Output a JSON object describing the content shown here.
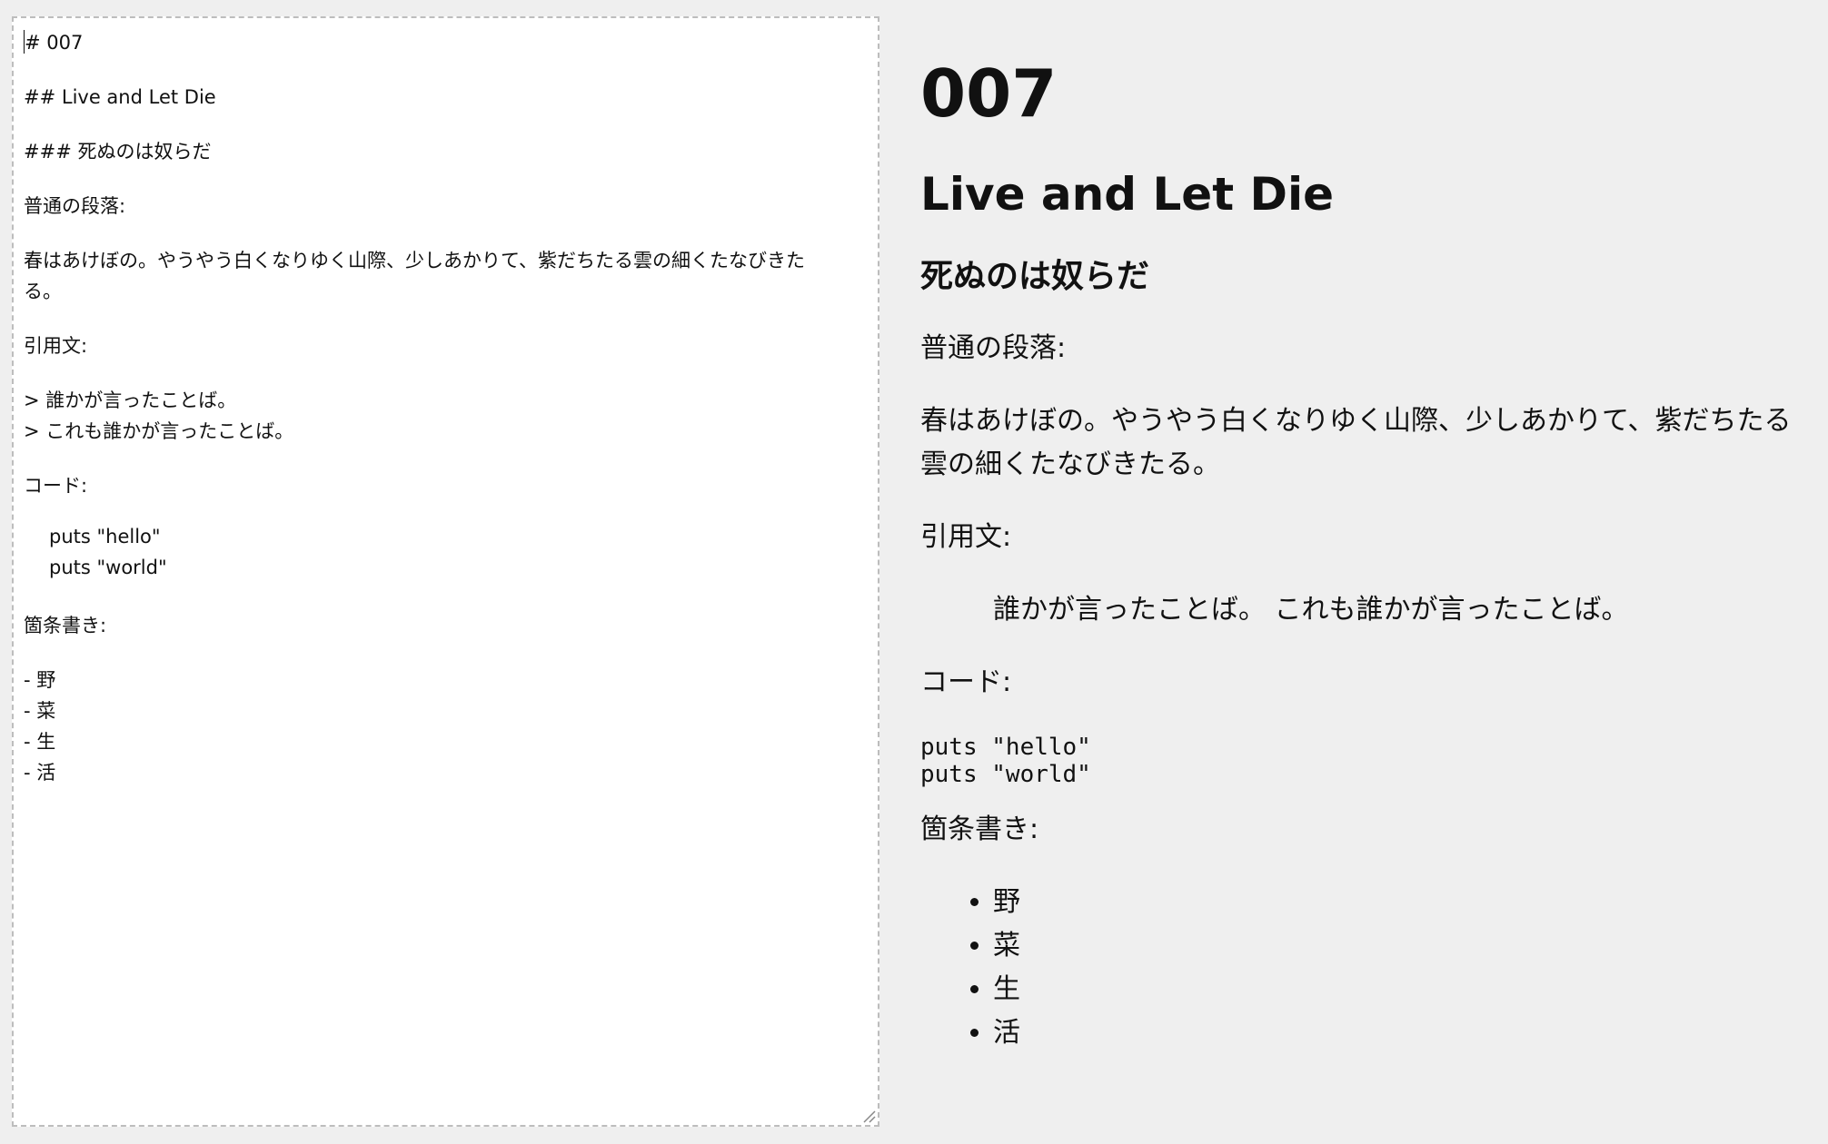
{
  "editor": {
    "lines": {
      "h1": "# 007",
      "h2": "## Live and Let Die",
      "h3": "### 死ぬのは奴らだ",
      "para_label": "普通の段落:",
      "paragraph": "春はあけぼの。やうやう白くなりゆく山際、少しあかりて、紫だちたる雲の細くたなびきたる。",
      "quote_label": "引用文:",
      "quote1": "> 誰かが言ったことば。",
      "quote2": "> これも誰かが言ったことば。",
      "code_label": "コード:",
      "code1": "puts \"hello\"",
      "code2": "puts \"world\"",
      "list_label": "箇条書き:",
      "list": [
        "- 野",
        "- 菜",
        "- 生",
        "- 活"
      ]
    },
    "resize_icon": "resize-grip-icon"
  },
  "preview": {
    "h1": "007",
    "h2": "Live and Let Die",
    "h3": "死ぬのは奴らだ",
    "para_label": "普通の段落:",
    "paragraph": "春はあけぼの。やうやう白くなりゆく山際、少しあかりて、紫だちたる雲の細くたなびきたる。",
    "quote_label": "引用文:",
    "quote": "誰かが言ったことば。 これも誰かが言ったことば。",
    "code_label": "コード:",
    "code": "puts \"hello\"\nputs \"world\"",
    "list_label": "箇条書き:",
    "list": [
      "野",
      "菜",
      "生",
      "活"
    ]
  },
  "colors": {
    "page_background": "#efefef",
    "editor_background": "#ffffff",
    "editor_border": "#bdbdbd",
    "text": "#111111"
  }
}
